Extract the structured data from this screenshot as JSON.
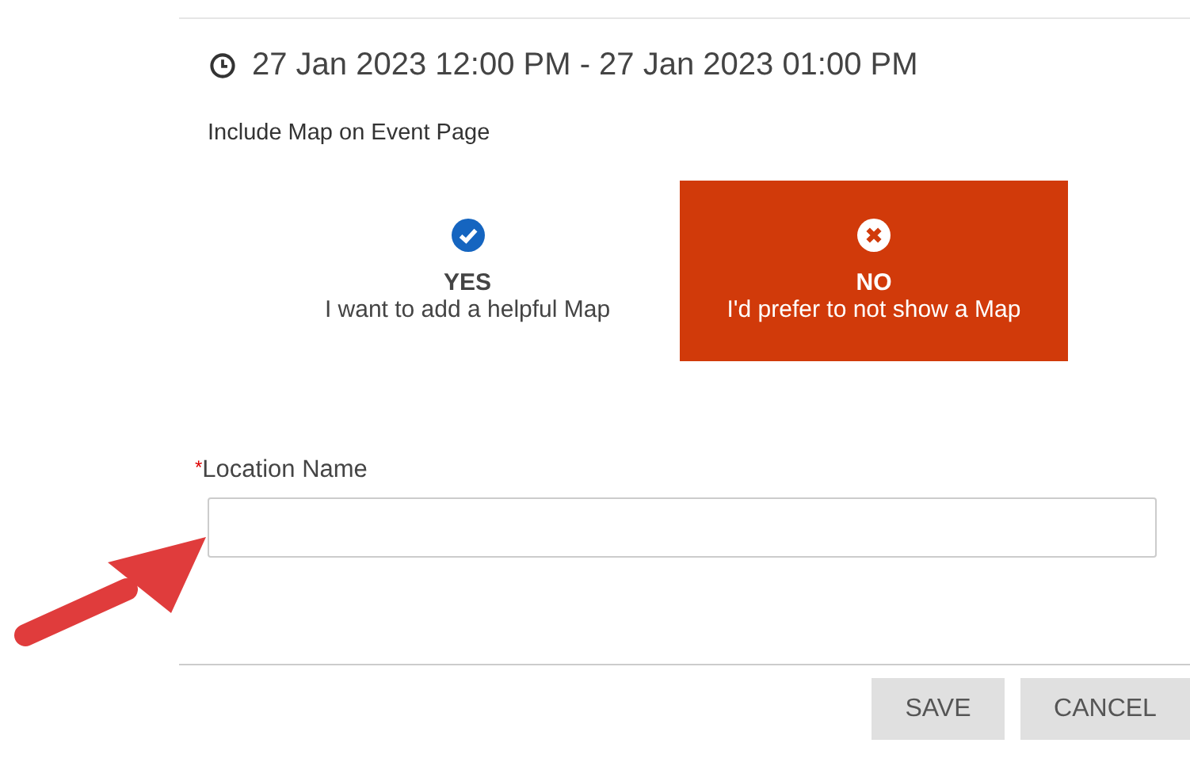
{
  "event_time": "27 Jan 2023 12:00 PM - 27 Jan 2023 01:00 PM",
  "map_question": "Include Map on Event Page",
  "map_options": [
    {
      "kind": "yes",
      "title": "YES",
      "subtitle": "I want to add a helpful Map",
      "selected": false
    },
    {
      "kind": "no",
      "title": "NO",
      "subtitle": "I'd prefer to not show a Map",
      "selected": true
    }
  ],
  "location_field": {
    "required_mark": "*",
    "label": "Location Name"
  },
  "buttons": [
    "SAVE",
    "CANCEL"
  ]
}
